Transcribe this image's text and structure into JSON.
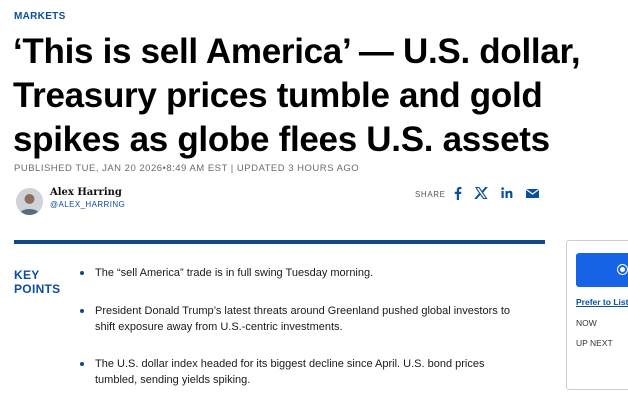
{
  "section": {
    "label": "MARKETS"
  },
  "headline": {
    "line1": "‘This is sell America’ — U.S. dollar,",
    "line2": "Treasury prices tumble and gold",
    "line3": "spikes as globe flees U.S. assets"
  },
  "published": "PUBLISHED TUE, JAN 20 2026•8:49 AM EST | UPDATED 3 HOURS AGO",
  "author": {
    "name": "Alex Harring",
    "handle": "@ALEX_HARRING"
  },
  "share": {
    "label": "SHARE",
    "icons": [
      "facebook-icon",
      "x-icon",
      "linkedin-icon",
      "email-icon"
    ],
    "color": "#0a4ea1"
  },
  "key_points": {
    "label_line1": "KEY",
    "label_line2": "POINTS",
    "items": [
      "The “sell America” trade is in full swing Tuesday morning.",
      "President Donald Trump’s latest threats around Greenland pushed global investors to shift exposure away from U.S.-centric investments.",
      "The U.S. dollar index headed for its biggest decline since April. U.S. bond prices tumbled, sending yields spiking."
    ]
  },
  "sidebar": {
    "link": "Prefer to Liste",
    "now": "NOW",
    "up_next": "UP NEXT"
  },
  "colors": {
    "accent": "#0a4ea1",
    "divider": "#0d4a8c",
    "button": "#1763e6"
  }
}
